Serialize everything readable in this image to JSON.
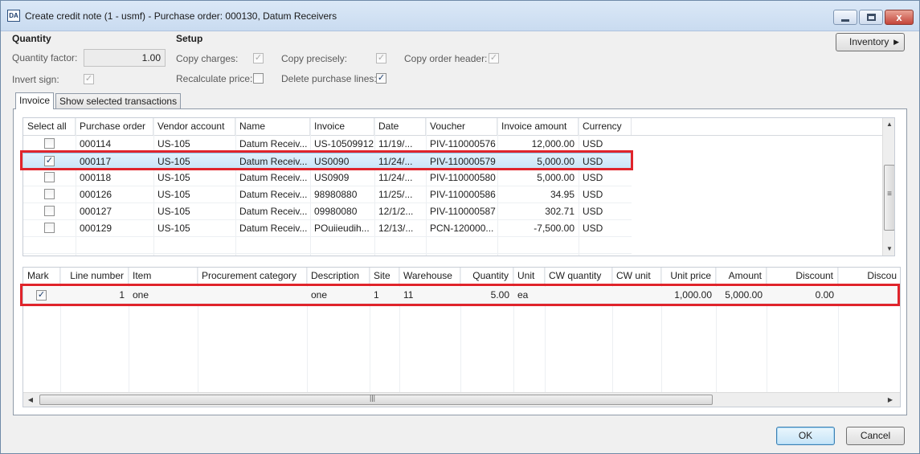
{
  "window": {
    "title": "Create credit note (1 - usmf) - Purchase order: 000130, Datum Receivers",
    "icon_label": "DA",
    "controls": {
      "minimize": "minimize-icon",
      "maximize": "maximize-icon",
      "close": "close-icon",
      "close_glyph": "x"
    }
  },
  "quantity_group": {
    "title": "Quantity",
    "quantity_factor_label": "Quantity factor:",
    "quantity_factor_value": "1.00",
    "invert_sign_label": "Invert sign:",
    "invert_sign_checked": true
  },
  "setup_group": {
    "title": "Setup",
    "copy_charges_label": "Copy charges:",
    "copy_charges_checked": true,
    "recalculate_price_label": "Recalculate price:",
    "recalculate_price_checked": false,
    "copy_precisely_label": "Copy precisely:",
    "copy_precisely_checked": true,
    "delete_purchase_lines_label": "Delete purchase lines:",
    "delete_purchase_lines_checked": true,
    "copy_order_header_label": "Copy order header:",
    "copy_order_header_checked": true
  },
  "toolbar": {
    "inventory_label": "Inventory",
    "inventory_arrow": "▶"
  },
  "tabs": [
    {
      "label": "Invoice",
      "active": true
    },
    {
      "label": "Show selected transactions",
      "active": false
    }
  ],
  "invoice_grid": {
    "columns": [
      "Select all",
      "Purchase order",
      "Vendor account",
      "Name",
      "Invoice",
      "Date",
      "Voucher",
      "Invoice amount",
      "Currency"
    ],
    "rows": [
      {
        "selected": false,
        "purchase_order": "000114",
        "vendor_account": "US-105",
        "name": "Datum Receiv...",
        "invoice": "US-10509912",
        "date": "11/19/...",
        "voucher": "PIV-110000576",
        "invoice_amount": "12,000.00",
        "currency": "USD"
      },
      {
        "selected": true,
        "purchase_order": "000117",
        "vendor_account": "US-105",
        "name": "Datum Receiv...",
        "invoice": "US0090",
        "date": "11/24/...",
        "voucher": "PIV-110000579",
        "invoice_amount": "5,000.00",
        "currency": "USD"
      },
      {
        "selected": false,
        "purchase_order": "000118",
        "vendor_account": "US-105",
        "name": "Datum Receiv...",
        "invoice": "US0909",
        "date": "11/24/...",
        "voucher": "PIV-110000580",
        "invoice_amount": "5,000.00",
        "currency": "USD"
      },
      {
        "selected": false,
        "purchase_order": "000126",
        "vendor_account": "US-105",
        "name": "Datum Receiv...",
        "invoice": "98980880",
        "date": "11/25/...",
        "voucher": "PIV-110000586",
        "invoice_amount": "34.95",
        "currency": "USD"
      },
      {
        "selected": false,
        "purchase_order": "000127",
        "vendor_account": "US-105",
        "name": "Datum Receiv...",
        "invoice": "09980080",
        "date": "12/1/2...",
        "voucher": "PIV-110000587",
        "invoice_amount": "302.71",
        "currency": "USD"
      },
      {
        "selected": false,
        "purchase_order": "000129",
        "vendor_account": "US-105",
        "name": "Datum Receiv...",
        "invoice": "POuiieudih...",
        "date": "12/13/...",
        "voucher": "PCN-120000...",
        "invoice_amount": "-7,500.00",
        "currency": "USD"
      }
    ]
  },
  "lines_grid": {
    "columns": [
      "Mark",
      "Line number",
      "Item",
      "Procurement category",
      "Description",
      "Site",
      "Warehouse",
      "Quantity",
      "Unit",
      "CW quantity",
      "CW unit",
      "Unit price",
      "Amount",
      "Discount",
      "Discou"
    ],
    "rows": [
      {
        "mark": true,
        "line_number": "1",
        "item": "one",
        "procurement_category": "",
        "description": "one",
        "site": "1",
        "warehouse": "11",
        "quantity": "5.00",
        "unit": "ea",
        "cw_quantity": "",
        "cw_unit": "",
        "unit_price": "1,000.00",
        "amount": "5,000.00",
        "discount": "0.00",
        "discount_pct": ""
      }
    ]
  },
  "scrollbars": {
    "up": "▲",
    "down": "▼",
    "left": "◀",
    "right": "▶",
    "grip_v": "≡",
    "grip_h": "|||"
  },
  "footer": {
    "ok_label": "OK",
    "cancel_label": "Cancel"
  },
  "colors": {
    "highlight_border": "#e0242b",
    "selection": "#c9e5f8",
    "accent": "#3c7fb1"
  }
}
